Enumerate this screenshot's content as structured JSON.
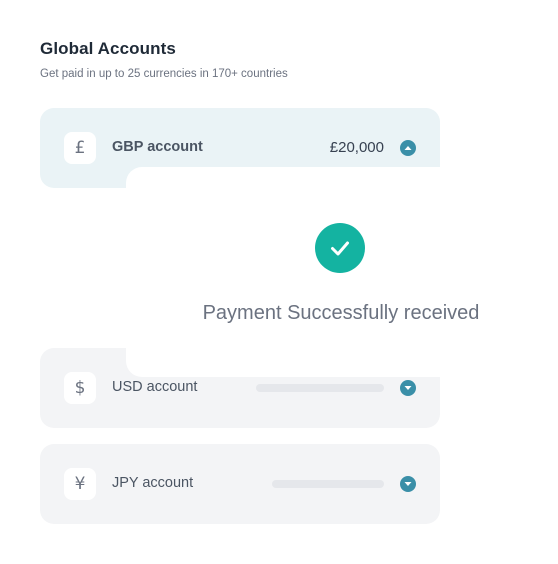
{
  "header": {
    "title": "Global Accounts",
    "subtitle": "Get paid in up to 25 currencies in 170+ countries"
  },
  "accounts": [
    {
      "name": "GBP account",
      "symbol": "£",
      "amount": "£20,000",
      "expanded": true,
      "icon": "pound-icon"
    },
    {
      "name": "USD account",
      "symbol": "$",
      "amount": "",
      "expanded": false,
      "icon": "dollar-icon"
    },
    {
      "name": "JPY account",
      "symbol": "¥",
      "amount": "",
      "expanded": false,
      "icon": "yen-icon"
    }
  ],
  "popup": {
    "message": "Payment Successfully received",
    "icon": "check-icon"
  },
  "colors": {
    "accent": "#3a8fa8",
    "success": "#14b3a1",
    "active_card": "#eaf3f6",
    "card": "#f3f4f6"
  }
}
